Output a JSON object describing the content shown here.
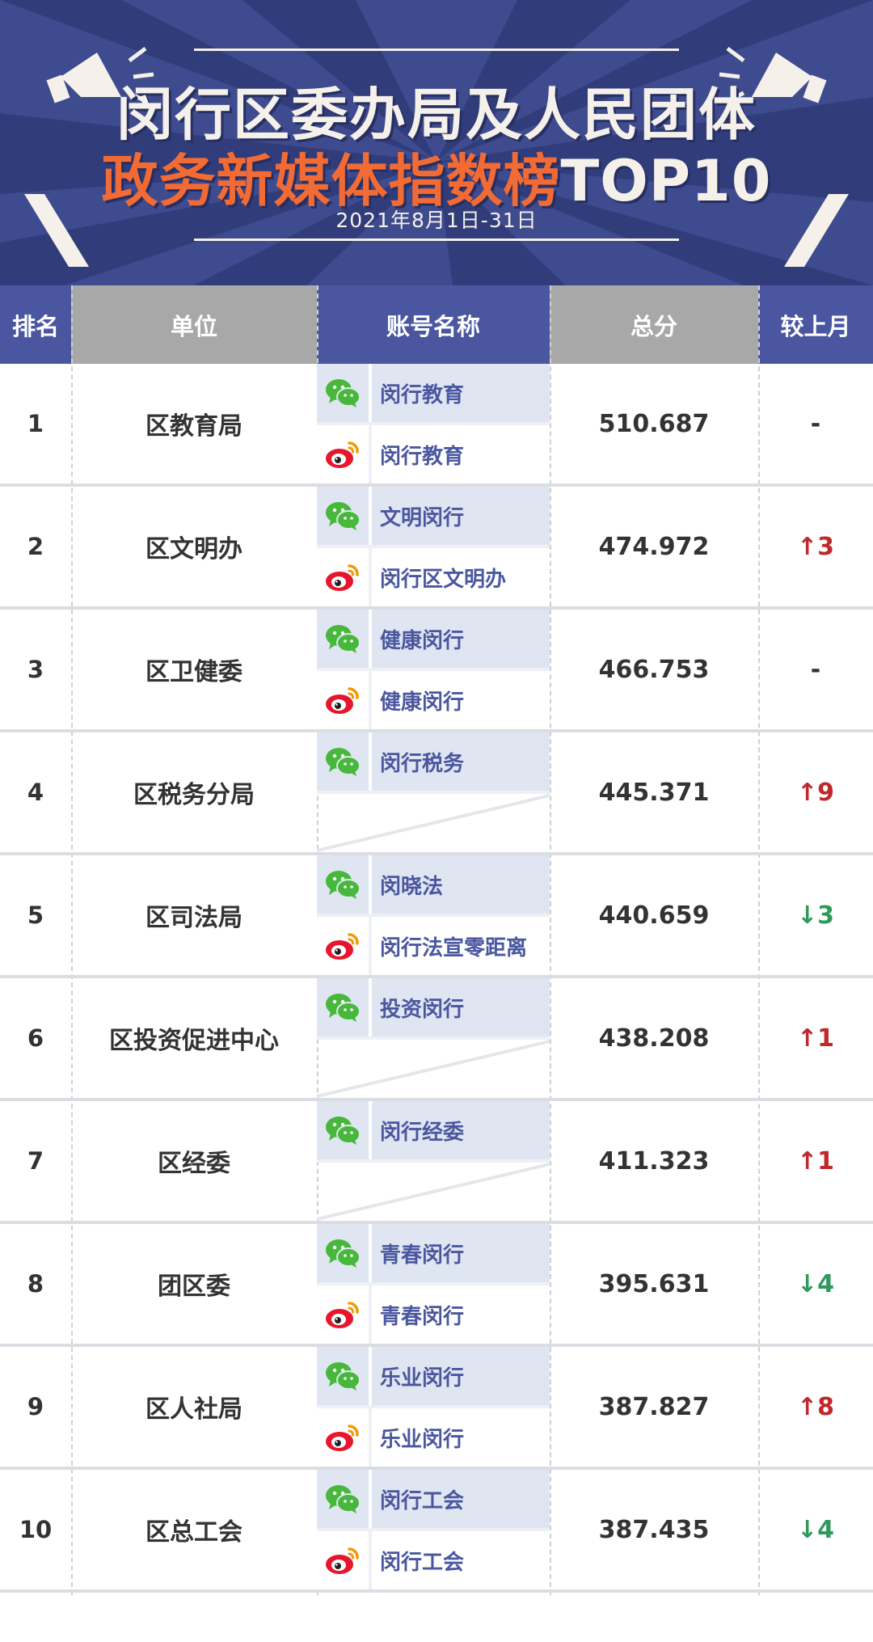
{
  "banner": {
    "title_line1": "闵行区委办局及人民团体",
    "title_line2_cn": "政务新媒体指数榜",
    "title_line2_en": "TOP10",
    "date_range": "2021年8月1日-31日"
  },
  "table": {
    "headers": {
      "rank": "排名",
      "unit": "单位",
      "account": "账号名称",
      "score": "总分",
      "change": "较上月"
    },
    "rows": [
      {
        "rank": "1",
        "unit": "区教育局",
        "wechat": "闵行教育",
        "weibo": "闵行教育",
        "score": "510.687",
        "change": "-",
        "trend": "flat"
      },
      {
        "rank": "2",
        "unit": "区文明办",
        "wechat": "文明闵行",
        "weibo": "闵行区文明办",
        "score": "474.972",
        "change": "↑3",
        "trend": "up"
      },
      {
        "rank": "3",
        "unit": "区卫健委",
        "wechat": "健康闵行",
        "weibo": "健康闵行",
        "score": "466.753",
        "change": "-",
        "trend": "flat"
      },
      {
        "rank": "4",
        "unit": "区税务分局",
        "wechat": "闵行税务",
        "weibo": "",
        "score": "445.371",
        "change": "↑9",
        "trend": "up"
      },
      {
        "rank": "5",
        "unit": "区司法局",
        "wechat": "闵晓法",
        "weibo": "闵行法宣零距离",
        "score": "440.659",
        "change": "↓3",
        "trend": "down"
      },
      {
        "rank": "6",
        "unit": "区投资促进中心",
        "wechat": "投资闵行",
        "weibo": "",
        "score": "438.208",
        "change": "↑1",
        "trend": "up"
      },
      {
        "rank": "7",
        "unit": "区经委",
        "wechat": "闵行经委",
        "weibo": "",
        "score": "411.323",
        "change": "↑1",
        "trend": "up"
      },
      {
        "rank": "8",
        "unit": "团区委",
        "wechat": "青春闵行",
        "weibo": "青春闵行",
        "score": "395.631",
        "change": "↓4",
        "trend": "down"
      },
      {
        "rank": "9",
        "unit": "区人社局",
        "wechat": "乐业闵行",
        "weibo": "乐业闵行",
        "score": "387.827",
        "change": "↑8",
        "trend": "up"
      },
      {
        "rank": "10",
        "unit": "区总工会",
        "wechat": "闵行工会",
        "weibo": "闵行工会",
        "score": "387.435",
        "change": "↓4",
        "trend": "down"
      }
    ]
  },
  "icons": {
    "wechat": "wechat-icon",
    "weibo": "weibo-icon"
  },
  "colors": {
    "banner_bg": "#3e4b8e",
    "header_blue": "#4a57a0",
    "header_gray": "#a8a8a8",
    "title_orange": "#f26b35",
    "account_text": "#4a57a0",
    "up": "#c0282c",
    "down": "#2e9a5c",
    "wechat_green": "#47b83c",
    "weibo_red": "#e6162d"
  }
}
